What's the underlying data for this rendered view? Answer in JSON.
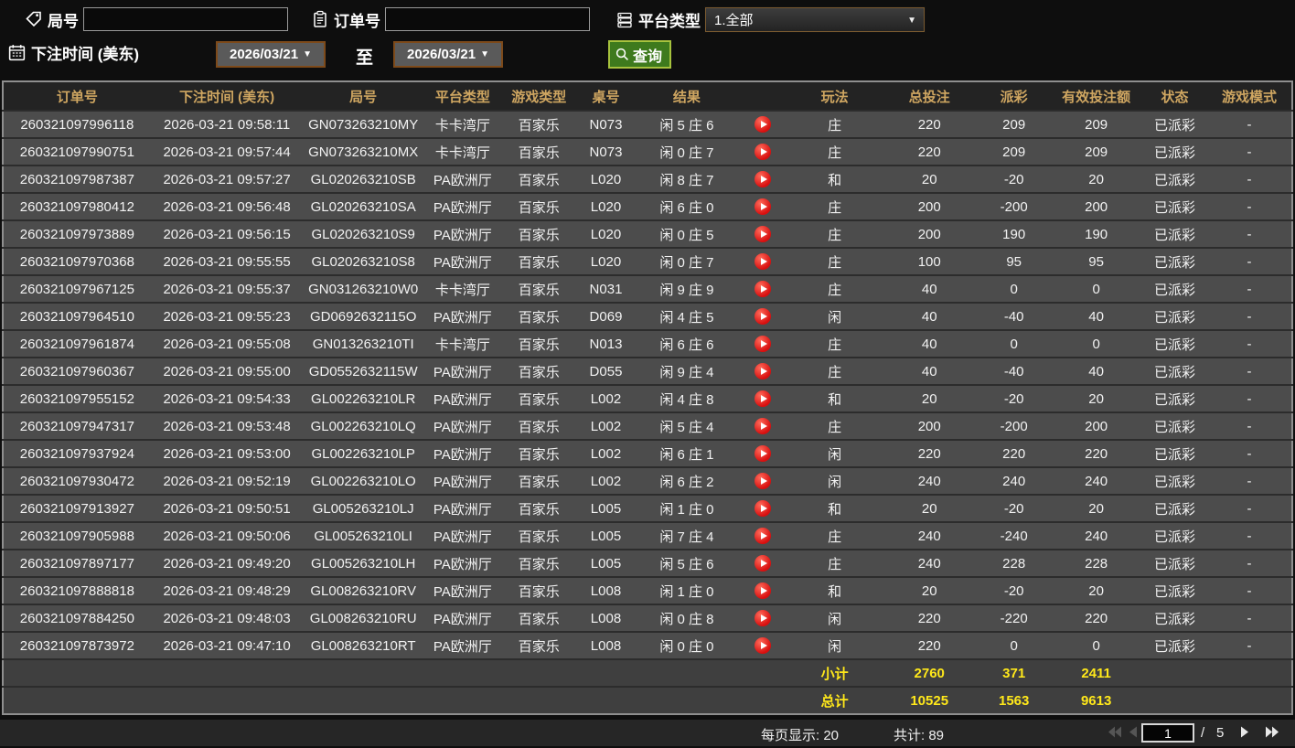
{
  "filters": {
    "game_no_label": "局号",
    "game_no_value": "",
    "order_no_label": "订单号",
    "order_no_value": "",
    "platform_label": "平台类型",
    "platform_value": "1.全部",
    "bet_time_label": "下注时间 (美东)",
    "date_from": "2026/03/21",
    "to_label": "至",
    "date_to": "2026/03/21",
    "search_label": "查询"
  },
  "table": {
    "headers": [
      "订单号",
      "下注时间 (美东)",
      "局号",
      "平台类型",
      "游戏类型",
      "桌号",
      "结果",
      "",
      "玩法",
      "总投注",
      "派彩",
      "有效投注额",
      "状态",
      "游戏模式"
    ],
    "rows": [
      {
        "order_no": "260321097996118",
        "bet_time": "2026-03-21 09:58:11",
        "game_no": "GN073263210MY",
        "platform": "卡卡湾厅",
        "game_type": "百家乐",
        "table_no": "N073",
        "result": "闲 5 庄 6",
        "play_type": "庄",
        "total_bet": 220,
        "payout": 209,
        "valid_bet": 209,
        "status": "已派彩",
        "mode": "-"
      },
      {
        "order_no": "260321097990751",
        "bet_time": "2026-03-21 09:57:44",
        "game_no": "GN073263210MX",
        "platform": "卡卡湾厅",
        "game_type": "百家乐",
        "table_no": "N073",
        "result": "闲 0 庄 7",
        "play_type": "庄",
        "total_bet": 220,
        "payout": 209,
        "valid_bet": 209,
        "status": "已派彩",
        "mode": "-"
      },
      {
        "order_no": "260321097987387",
        "bet_time": "2026-03-21 09:57:27",
        "game_no": "GL020263210SB",
        "platform": "PA欧洲厅",
        "game_type": "百家乐",
        "table_no": "L020",
        "result": "闲 8 庄 7",
        "play_type": "和",
        "total_bet": 20,
        "payout": -20,
        "valid_bet": 20,
        "status": "已派彩",
        "mode": "-"
      },
      {
        "order_no": "260321097980412",
        "bet_time": "2026-03-21 09:56:48",
        "game_no": "GL020263210SA",
        "platform": "PA欧洲厅",
        "game_type": "百家乐",
        "table_no": "L020",
        "result": "闲 6 庄 0",
        "play_type": "庄",
        "total_bet": 200,
        "payout": -200,
        "valid_bet": 200,
        "status": "已派彩",
        "mode": "-"
      },
      {
        "order_no": "260321097973889",
        "bet_time": "2026-03-21 09:56:15",
        "game_no": "GL020263210S9",
        "platform": "PA欧洲厅",
        "game_type": "百家乐",
        "table_no": "L020",
        "result": "闲 0 庄 5",
        "play_type": "庄",
        "total_bet": 200,
        "payout": 190,
        "valid_bet": 190,
        "status": "已派彩",
        "mode": "-"
      },
      {
        "order_no": "260321097970368",
        "bet_time": "2026-03-21 09:55:55",
        "game_no": "GL020263210S8",
        "platform": "PA欧洲厅",
        "game_type": "百家乐",
        "table_no": "L020",
        "result": "闲 0 庄 7",
        "play_type": "庄",
        "total_bet": 100,
        "payout": 95,
        "valid_bet": 95,
        "status": "已派彩",
        "mode": "-"
      },
      {
        "order_no": "260321097967125",
        "bet_time": "2026-03-21 09:55:37",
        "game_no": "GN031263210W0",
        "platform": "卡卡湾厅",
        "game_type": "百家乐",
        "table_no": "N031",
        "result": "闲 9 庄 9",
        "play_type": "庄",
        "total_bet": 40,
        "payout": 0,
        "valid_bet": 0,
        "status": "已派彩",
        "mode": "-"
      },
      {
        "order_no": "260321097964510",
        "bet_time": "2026-03-21 09:55:23",
        "game_no": "GD0692632115O",
        "platform": "PA欧洲厅",
        "game_type": "百家乐",
        "table_no": "D069",
        "result": "闲 4 庄 5",
        "play_type": "闲",
        "total_bet": 40,
        "payout": -40,
        "valid_bet": 40,
        "status": "已派彩",
        "mode": "-"
      },
      {
        "order_no": "260321097961874",
        "bet_time": "2026-03-21 09:55:08",
        "game_no": "GN013263210TI",
        "platform": "卡卡湾厅",
        "game_type": "百家乐",
        "table_no": "N013",
        "result": "闲 6 庄 6",
        "play_type": "庄",
        "total_bet": 40,
        "payout": 0,
        "valid_bet": 0,
        "status": "已派彩",
        "mode": "-"
      },
      {
        "order_no": "260321097960367",
        "bet_time": "2026-03-21 09:55:00",
        "game_no": "GD0552632115W",
        "platform": "PA欧洲厅",
        "game_type": "百家乐",
        "table_no": "D055",
        "result": "闲 9 庄 4",
        "play_type": "庄",
        "total_bet": 40,
        "payout": -40,
        "valid_bet": 40,
        "status": "已派彩",
        "mode": "-"
      },
      {
        "order_no": "260321097955152",
        "bet_time": "2026-03-21 09:54:33",
        "game_no": "GL002263210LR",
        "platform": "PA欧洲厅",
        "game_type": "百家乐",
        "table_no": "L002",
        "result": "闲 4 庄 8",
        "play_type": "和",
        "total_bet": 20,
        "payout": -20,
        "valid_bet": 20,
        "status": "已派彩",
        "mode": "-"
      },
      {
        "order_no": "260321097947317",
        "bet_time": "2026-03-21 09:53:48",
        "game_no": "GL002263210LQ",
        "platform": "PA欧洲厅",
        "game_type": "百家乐",
        "table_no": "L002",
        "result": "闲 5 庄 4",
        "play_type": "庄",
        "total_bet": 200,
        "payout": -200,
        "valid_bet": 200,
        "status": "已派彩",
        "mode": "-"
      },
      {
        "order_no": "260321097937924",
        "bet_time": "2026-03-21 09:53:00",
        "game_no": "GL002263210LP",
        "platform": "PA欧洲厅",
        "game_type": "百家乐",
        "table_no": "L002",
        "result": "闲 6 庄 1",
        "play_type": "闲",
        "total_bet": 220,
        "payout": 220,
        "valid_bet": 220,
        "status": "已派彩",
        "mode": "-"
      },
      {
        "order_no": "260321097930472",
        "bet_time": "2026-03-21 09:52:19",
        "game_no": "GL002263210LO",
        "platform": "PA欧洲厅",
        "game_type": "百家乐",
        "table_no": "L002",
        "result": "闲 6 庄 2",
        "play_type": "闲",
        "total_bet": 240,
        "payout": 240,
        "valid_bet": 240,
        "status": "已派彩",
        "mode": "-"
      },
      {
        "order_no": "260321097913927",
        "bet_time": "2026-03-21 09:50:51",
        "game_no": "GL005263210LJ",
        "platform": "PA欧洲厅",
        "game_type": "百家乐",
        "table_no": "L005",
        "result": "闲 1 庄 0",
        "play_type": "和",
        "total_bet": 20,
        "payout": -20,
        "valid_bet": 20,
        "status": "已派彩",
        "mode": "-"
      },
      {
        "order_no": "260321097905988",
        "bet_time": "2026-03-21 09:50:06",
        "game_no": "GL005263210LI",
        "platform": "PA欧洲厅",
        "game_type": "百家乐",
        "table_no": "L005",
        "result": "闲 7 庄 4",
        "play_type": "庄",
        "total_bet": 240,
        "payout": -240,
        "valid_bet": 240,
        "status": "已派彩",
        "mode": "-"
      },
      {
        "order_no": "260321097897177",
        "bet_time": "2026-03-21 09:49:20",
        "game_no": "GL005263210LH",
        "platform": "PA欧洲厅",
        "game_type": "百家乐",
        "table_no": "L005",
        "result": "闲 5 庄 6",
        "play_type": "庄",
        "total_bet": 240,
        "payout": 228,
        "valid_bet": 228,
        "status": "已派彩",
        "mode": "-"
      },
      {
        "order_no": "260321097888818",
        "bet_time": "2026-03-21 09:48:29",
        "game_no": "GL008263210RV",
        "platform": "PA欧洲厅",
        "game_type": "百家乐",
        "table_no": "L008",
        "result": "闲 1 庄 0",
        "play_type": "和",
        "total_bet": 20,
        "payout": -20,
        "valid_bet": 20,
        "status": "已派彩",
        "mode": "-"
      },
      {
        "order_no": "260321097884250",
        "bet_time": "2026-03-21 09:48:03",
        "game_no": "GL008263210RU",
        "platform": "PA欧洲厅",
        "game_type": "百家乐",
        "table_no": "L008",
        "result": "闲 0 庄 8",
        "play_type": "闲",
        "total_bet": 220,
        "payout": -220,
        "valid_bet": 220,
        "status": "已派彩",
        "mode": "-"
      },
      {
        "order_no": "260321097873972",
        "bet_time": "2026-03-21 09:47:10",
        "game_no": "GL008263210RT",
        "platform": "PA欧洲厅",
        "game_type": "百家乐",
        "table_no": "L008",
        "result": "闲 0 庄 0",
        "play_type": "闲",
        "total_bet": 220,
        "payout": 0,
        "valid_bet": 0,
        "status": "已派彩",
        "mode": "-"
      }
    ],
    "subtotal": {
      "label": "小计",
      "total_bet": "2760",
      "payout": "371",
      "valid_bet": "2411"
    },
    "total": {
      "label": "总计",
      "total_bet": "10525",
      "payout": "1563",
      "valid_bet": "9613"
    }
  },
  "footer": {
    "page_size_label": "每页显示: 20",
    "total_count_label": "共计: 89",
    "current_page": "1",
    "page_separator": "/",
    "total_pages": "5"
  },
  "icons": {
    "game_no": "tag-icon",
    "order_no": "clipboard-icon",
    "platform": "server-icon",
    "bet_time": "calendar-icon",
    "search": "search-icon",
    "replay": "play-icon",
    "pagination": [
      "first-page-icon",
      "prev-page-icon",
      "next-page-icon",
      "last-page-icon"
    ]
  },
  "colors": {
    "header_text": "#cfa661",
    "payout_win": "#c22f3e",
    "payout_loss": "#9acd32",
    "status_paid": "#2ed04e",
    "summary_text": "#ffe81a",
    "search_button": "#3e7a1d",
    "play_button": "#d80f0f",
    "date_border": "#7d4a1a",
    "row_bg": "#4c4c4c"
  }
}
